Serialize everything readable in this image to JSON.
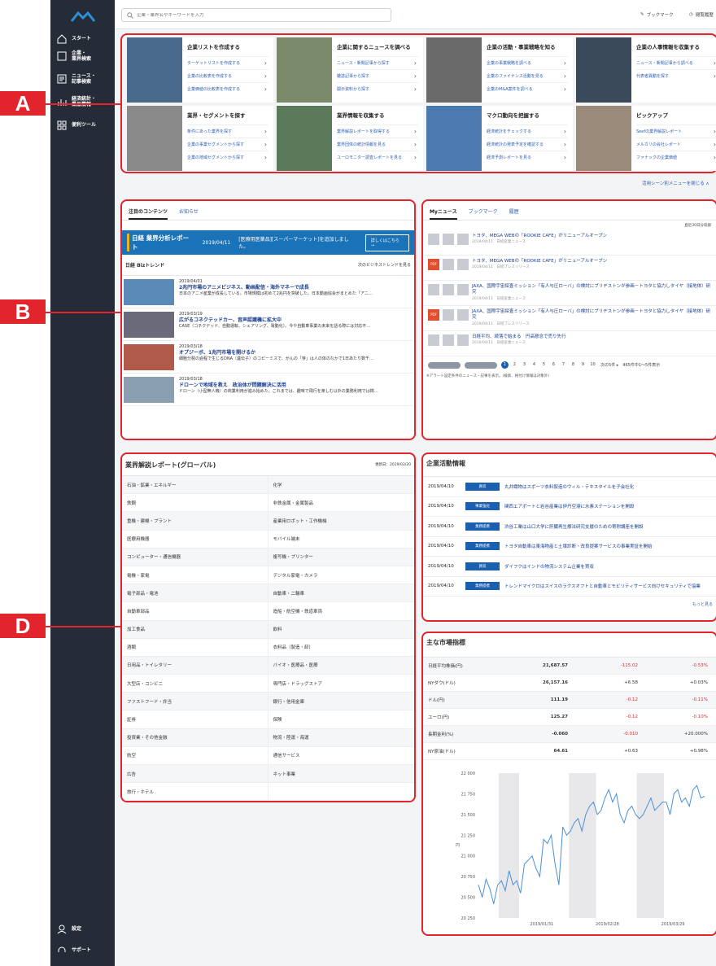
{
  "callouts": {
    "a": "A",
    "b": "B",
    "d": "D"
  },
  "sidebar": {
    "items": [
      {
        "label": "スタート",
        "icon": "home-icon"
      },
      {
        "label": "企業・\n業界検索",
        "icon": "building-icon"
      },
      {
        "label": "ニュース・\n記事検索",
        "icon": "news-icon"
      },
      {
        "label": "経済統計・\n業品情報",
        "icon": "stats-icon"
      },
      {
        "label": "便利ツール",
        "icon": "grid-icon"
      }
    ],
    "settings": "設定",
    "support": "サポート"
  },
  "header": {
    "search_placeholder": "企業・業界名やキーワードを入力",
    "bookmark": "ブックマーク",
    "history": "閲覧履歴"
  },
  "menu": {
    "tiles": [
      {
        "title": "企業リストを作成する",
        "links": [
          "ターゲットリストを作成する",
          "企業の比較表を作成する",
          "企業価値の比較表を作成する"
        ]
      },
      {
        "title": "企業に関するニュースを調べる",
        "links": [
          "ニュース・新聞記事から探す",
          "雑誌記事から探す",
          "開示資料から探す"
        ]
      },
      {
        "title": "企業の活動・事業戦略を知る",
        "links": [
          "企業の事業戦略を調べる",
          "企業のファイナンス活動を見る",
          "企業のM&A案件を調べる"
        ]
      },
      {
        "title": "企業の人事情報を収集する",
        "links": [
          "ニュース・新聞記事から調べる",
          "代表者異動を探す"
        ]
      },
      {
        "title": "業界・セグメントを探す",
        "links": [
          "条件にあった業界を探す",
          "企業の事業セグメントから探す",
          "企業の地域セグメントから探す"
        ]
      },
      {
        "title": "業界情報を収集する",
        "links": [
          "業界解説レポートを取得する",
          "業界団体の統計情報を見る",
          "ユーロモニター調査レポートを見る"
        ]
      },
      {
        "title": "マクロ動向を把握する",
        "links": [
          "経済統計をチェックする",
          "経済統計の発表予定を確認する",
          "経済予測レポートを見る"
        ]
      },
      {
        "title": "ピックアップ",
        "links": [
          "Seefの業界解説レポート",
          "メルカリの会社レポート",
          "ファナックの企業価値"
        ]
      }
    ],
    "close": "活用シーン別メニューを閉じる ∧"
  },
  "featured": {
    "tabs": [
      "注目のコンテンツ",
      "お知らせ"
    ],
    "banner": {
      "lead": "日経 業界分析レポート",
      "date": "2019/04/11",
      "text": "[医療用医薬品][スーパーマーケット]を追加しました。",
      "button": "詳しくはこちら →"
    },
    "section": "日経 Bizトレンド",
    "more": "次のビジネストレンドを見る",
    "trends": [
      {
        "date": "2019/04/01",
        "title": "2兆円市場のアニメビジネス、動画配信・海外マネーで成長",
        "text": "日本のアニメ産業が成長している。市場規模は初めて2兆円を突破した。日本動画協会がまとめた「アニ…"
      },
      {
        "date": "2019/03/19",
        "title": "広がるコネクテッドカー、音声認識機に拡大中",
        "text": "CASE（コネクテッド、自動運転、シェアリング、電動化）。今や自動車事業の未来を語る際には対応不…"
      },
      {
        "date": "2019/03/18",
        "title": "オプジーボ、1兆円市場を開けるか",
        "text": "細胞分裂の過程で生じるDNA（遺伝子）のコピーミスで、がんの「芽」は人の体のなかで1日あたり数千…"
      },
      {
        "date": "2019/03/18",
        "title": "ドローンで地域を救え　政治体が問題解決に活用",
        "text": "ドローン（小型無人機）の商業利用が進み始めた。これまでは、趣味で飛行を楽しむ以外の業務利用では検…"
      }
    ]
  },
  "mynews": {
    "tabs": [
      "Myニュース",
      "ブックマーク",
      "履歴"
    ],
    "range": "直近30日分収録",
    "items": [
      {
        "title": "トヨタ、MEGA WEBの「ROOKIE CAFE」がリニューアルオープン",
        "meta": "2019/04/11　日経産業ニュース",
        "pdf": false
      },
      {
        "title": "トヨタ、MEGA WEBの「ROOKIE CAFE」がリニューアルオープン",
        "meta": "2019/04/11　日経プレスリリース",
        "pdf": true
      },
      {
        "title": "JAXA、国際宇宙探査ミッション「有人与圧ローバ」の検討にブリヂストンが参画－トヨタと協力しタイヤ（接地体）研究",
        "meta": "2019/04/11　日経産業ニュース",
        "pdf": false
      },
      {
        "title": "JAXA、国際宇宙探査ミッション「有人与圧ローバ」の検討にブリヂストンが参画－トヨタと協力しタイヤ（接地体）研究",
        "meta": "2019/04/11　日経プレスリリース",
        "pdf": true
      },
      {
        "title": "日経平均、続落で始まる　円高懸念で売り先行",
        "meta": "2019/04/11　日経産業ニュース",
        "pdf": false
      }
    ],
    "pages": [
      "1",
      "2",
      "3",
      "4",
      "5",
      "6",
      "7",
      "8",
      "9",
      "10"
    ],
    "next": "次の5件 ▸",
    "count": "465件中1〜5件表示",
    "note": "※アラート設定条件のニュース・記事を表示。(検索、格付け情報は対象外)"
  },
  "reports": {
    "title": "業界解説レポート(グローバル)",
    "updated": "更新日：2019/03/20",
    "items": [
      "石油・鉱業・エネルギー",
      "化学",
      "鉄鋼",
      "非鉄金属・金属製品",
      "重機・建機・プラント",
      "産業用ロボット・工作機械",
      "医療用機器",
      "モバイル端末",
      "コンピューター・通信機器",
      "複写機・プリンター",
      "電機・家電",
      "デジタル家電・カメラ",
      "電子部品・電池",
      "自動車・二輪車",
      "自動車部品",
      "造船・航空機・鉄道車両",
      "加工食品",
      "飲料",
      "酒類",
      "衣料品（製造・卸）",
      "日用品・トイレタリー",
      "バイオ・医療品・医療",
      "大型店・コンビニ",
      "専門店・ドラッグストア",
      "ファストフード・弁当",
      "銀行・信用金庫",
      "証券",
      "保険",
      "投資業・その他金融",
      "物流・陸運・海運",
      "航空",
      "通信サービス",
      "広告",
      "ネット事業",
      "旅行・ホテル",
      ""
    ]
  },
  "activity": {
    "title": "企業活動情報",
    "more": "もっと見る",
    "items": [
      {
        "date": "2019/04/10",
        "tag": "買収",
        "text": "丸井織物はスポーツ衣料製造のウィル・テキスタイルを子会社化"
      },
      {
        "date": "2019/04/10",
        "tag": "事業強化",
        "text": "関西エアポートと岩谷産業は伊丹空港に水素ステーションを開設"
      },
      {
        "date": "2019/04/10",
        "tag": "業務提携",
        "text": "渋谷工業は山口大学に肝臓再生療法研究支援のための寄附講座を開設"
      },
      {
        "date": "2019/04/10",
        "tag": "業務提携",
        "text": "トヨタ自動車は東海物産と土壌診断・改良提案サービスの事業実証を開始"
      },
      {
        "date": "2019/04/10",
        "tag": "買収",
        "text": "ダイフクはインドの物流システム企業を買収"
      },
      {
        "date": "2019/04/10",
        "tag": "業務提携",
        "text": "トレンドマイクロはスイスのラクスオフトと自動車とモビリティサービス向けセキュリティで協業"
      }
    ]
  },
  "market": {
    "title": "主な市場指標",
    "rows": [
      {
        "name": "日経平均株価(円)",
        "value": "21,687.57",
        "chg": "-115.02",
        "pct": "-0.53%"
      },
      {
        "name": "NYダウ(ドル)",
        "value": "26,157.16",
        "chg": "+6.58",
        "pct": "+0.03%"
      },
      {
        "name": "ドル(円)",
        "value": "111.19",
        "chg": "-0.12",
        "pct": "-0.11%"
      },
      {
        "name": "ユーロ(円)",
        "value": "125.27",
        "chg": "-0.12",
        "pct": "-0.10%"
      },
      {
        "name": "長期金利(%)",
        "value": "-0.060",
        "chg": "-0.010",
        "pct": "+20.000%"
      },
      {
        "name": "NY原油(ドル)",
        "value": "64.61",
        "chg": "+0.63",
        "pct": "+0.98%"
      }
    ]
  },
  "chart_data": {
    "type": "line",
    "ylabel": "円",
    "ylim": [
      20250,
      22000
    ],
    "yticks": [
      "22 000",
      "21 750",
      "21 500",
      "21 250",
      "21 000",
      "20 750",
      "20 500",
      "20 250"
    ],
    "xticks": [
      "2019/01/31",
      "2019/02/28",
      "2019/03/29"
    ],
    "values": [
      20650,
      20500,
      20720,
      20600,
      20420,
      20650,
      20700,
      20580,
      20820,
      20650,
      20700,
      20550,
      20900,
      20950,
      21000,
      20850,
      20750,
      21200,
      21150,
      21250,
      20900,
      20650,
      21350,
      21250,
      21300,
      21400,
      21450,
      21300,
      21500,
      21600,
      21650,
      21500,
      21550,
      21700,
      21800,
      21650,
      21750,
      21500,
      21400,
      21550,
      21600,
      21500,
      21450,
      21500,
      21600,
      21700,
      21550,
      21600,
      21650,
      21650,
      21500,
      21750,
      21800,
      21650,
      21700,
      21600,
      21800,
      21850,
      21700,
      21720
    ]
  },
  "colors": {
    "accent": "#e2242d",
    "brand": "#1a5fb0",
    "sidebar": "#252c38"
  }
}
